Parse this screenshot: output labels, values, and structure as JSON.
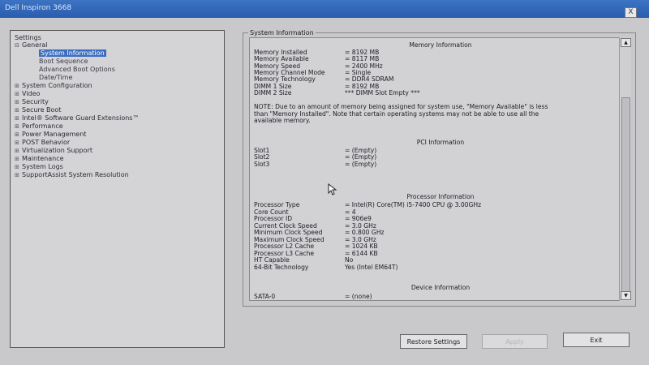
{
  "window": {
    "title": "Dell Inspiron 3668",
    "close_label": "X"
  },
  "tree": {
    "header": "Settings",
    "nodes": [
      {
        "label": "General",
        "marker": "⊟"
      },
      {
        "label": "System Information",
        "selected": true
      },
      {
        "label": "Boot Sequence"
      },
      {
        "label": "Advanced Boot Options"
      },
      {
        "label": "Date/Time"
      },
      {
        "label": "System Configuration",
        "marker": "⊞"
      },
      {
        "label": "Video",
        "marker": "⊞"
      },
      {
        "label": "Security",
        "marker": "⊞"
      },
      {
        "label": "Secure Boot",
        "marker": "⊞"
      },
      {
        "label": "Intel® Software Guard Extensions™",
        "marker": "⊞"
      },
      {
        "label": "Performance",
        "marker": "⊞"
      },
      {
        "label": "Power Management",
        "marker": "⊞"
      },
      {
        "label": "POST Behavior",
        "marker": "⊞"
      },
      {
        "label": "Virtualization Support",
        "marker": "⊞"
      },
      {
        "label": "Maintenance",
        "marker": "⊞"
      },
      {
        "label": "System Logs",
        "marker": "⊞"
      },
      {
        "label": "SupportAssist System Resolution",
        "marker": "⊞"
      }
    ]
  },
  "panel": {
    "title": "System Information",
    "memory": {
      "heading": "Memory Information",
      "rows": [
        {
          "key": "Memory Installed",
          "value": "= 8192 MB"
        },
        {
          "key": "Memory Available",
          "value": "= 8117 MB"
        },
        {
          "key": "Memory Speed",
          "value": "= 2400 MHz"
        },
        {
          "key": "Memory Channel Mode",
          "value": "= Single"
        },
        {
          "key": "Memory Technology",
          "value": "= DDR4 SDRAM"
        },
        {
          "key": "DIMM 1 Size",
          "value": "= 8192 MB"
        },
        {
          "key": "DIMM 2 Size",
          "value": "*** DIMM Slot Empty ***"
        }
      ],
      "note": [
        "NOTE: Due to an amount of memory being assigned for system use, \"Memory Available\" is less",
        "than \"Memory Installed\". Note that certain operating systems may not be able to use all the",
        "available memory."
      ]
    },
    "pci": {
      "heading": "PCI Information",
      "rows": [
        {
          "key": "Slot1",
          "value": "= (Empty)"
        },
        {
          "key": "Slot2",
          "value": "= (Empty)"
        },
        {
          "key": "Slot3",
          "value": "= (Empty)"
        }
      ]
    },
    "processor": {
      "heading": "Processor Information",
      "rows": [
        {
          "key": "Processor Type",
          "value": "= Intel(R) Core(TM) i5-7400 CPU @ 3.00GHz"
        },
        {
          "key": "Core Count",
          "value": "= 4"
        },
        {
          "key": "Processor ID",
          "value": "= 906e9"
        },
        {
          "key": "Current Clock Speed",
          "value": "= 3.0 GHz"
        },
        {
          "key": "Minimum Clock Speed",
          "value": "= 0.800 GHz"
        },
        {
          "key": "Maximum Clock Speed",
          "value": "= 3.0 GHz"
        },
        {
          "key": "Processor L2 Cache",
          "value": "= 1024 KB"
        },
        {
          "key": "Processor L3 Cache",
          "value": "= 6144 KB"
        },
        {
          "key": "HT Capable",
          "value": "No"
        },
        {
          "key": "64-Bit Technology",
          "value": "Yes (Intel EM64T)"
        }
      ]
    },
    "device": {
      "heading": "Device Information",
      "rows": [
        {
          "key": "SATA-0",
          "value": "= (none)"
        }
      ]
    }
  },
  "buttons": {
    "restore": "Restore Settings",
    "apply": "Apply",
    "exit": "Exit"
  }
}
